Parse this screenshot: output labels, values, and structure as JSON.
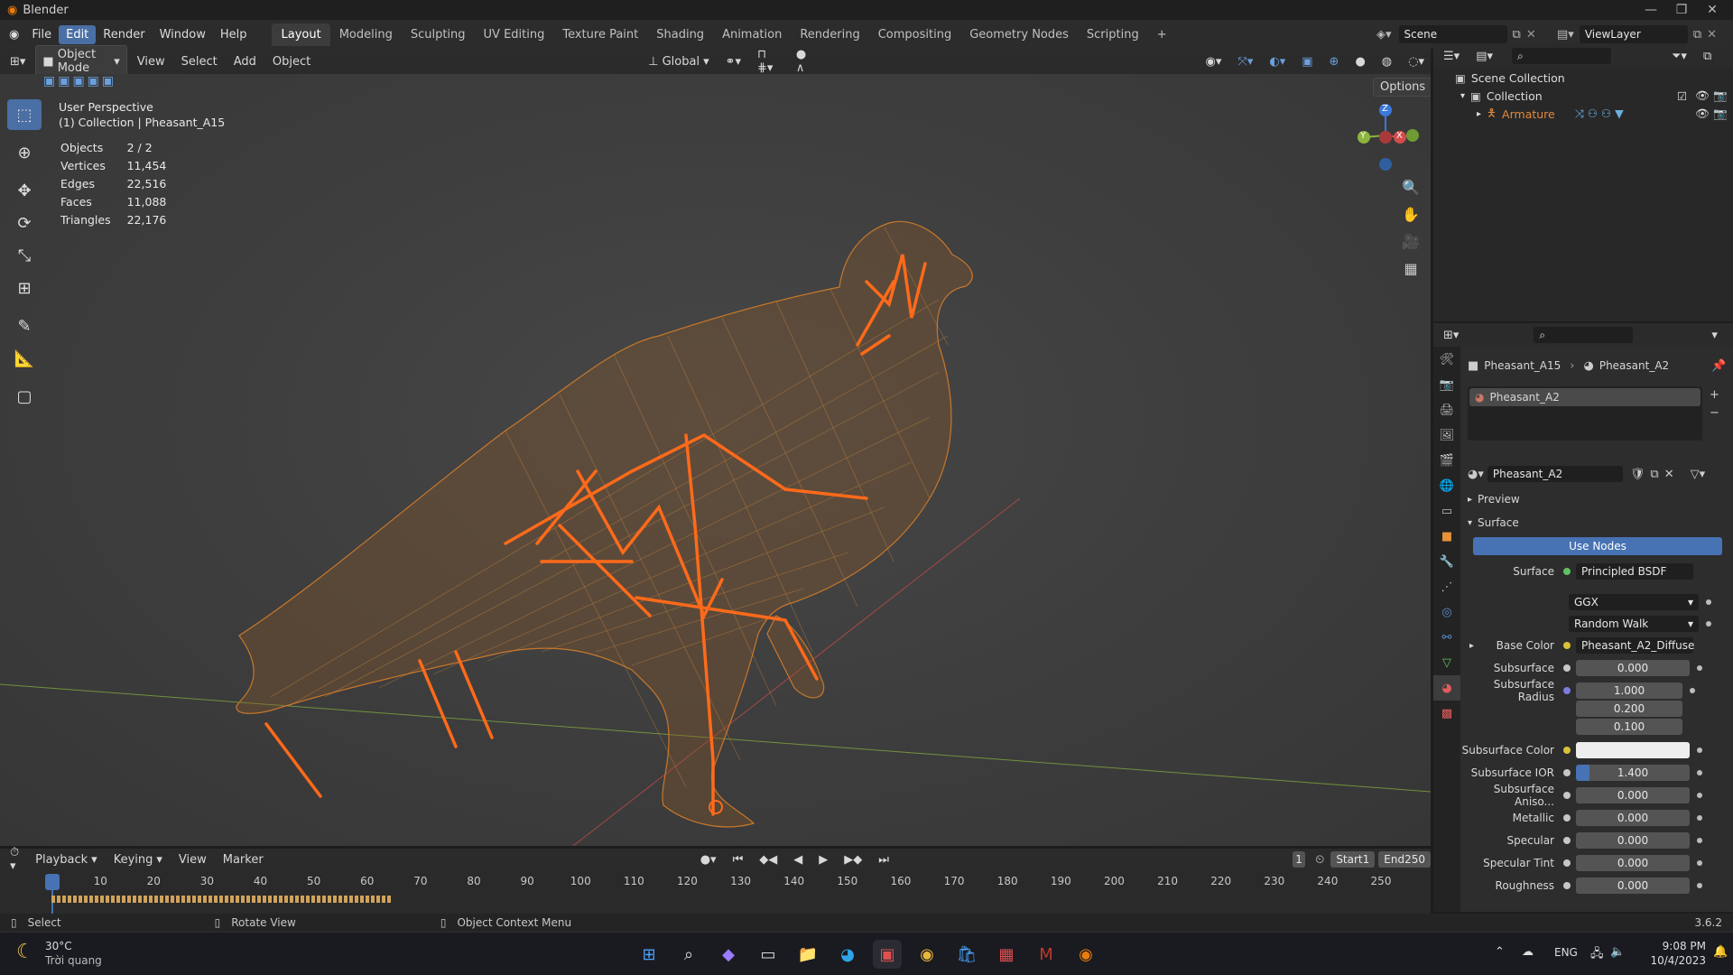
{
  "app": {
    "title": "Blender",
    "version": "3.6.2",
    "menus": [
      "File",
      "Edit",
      "Render",
      "Window",
      "Help"
    ],
    "active_menu": "Edit",
    "workspaces": [
      "Layout",
      "Modeling",
      "Sculpting",
      "UV Editing",
      "Texture Paint",
      "Shading",
      "Animation",
      "Rendering",
      "Compositing",
      "Geometry Nodes",
      "Scripting"
    ],
    "active_workspace": "Layout",
    "scene": "Scene",
    "view_layer": "ViewLayer"
  },
  "viewport_header": {
    "mode": "Object Mode",
    "menus": [
      "View",
      "Select",
      "Add",
      "Object"
    ],
    "orientation": "Global",
    "options_label": "Options"
  },
  "viewport": {
    "perspective": "User Perspective",
    "collection_line": "(1) Collection | Pheasant_A15",
    "stats": [
      {
        "label": "Objects",
        "value": "2 / 2"
      },
      {
        "label": "Vertices",
        "value": "11,454"
      },
      {
        "label": "Edges",
        "value": "22,516"
      },
      {
        "label": "Faces",
        "value": "11,088"
      },
      {
        "label": "Triangles",
        "value": "22,176"
      }
    ],
    "gizmo_axes": [
      "Z",
      "Y",
      "X"
    ],
    "colors": {
      "wire": "#c7772b",
      "bone": "#ff6a1a",
      "axis_x": "#d44b4b",
      "axis_y": "#8cb53c",
      "axis_z": "#3c78d8"
    }
  },
  "outliner": {
    "root": "Scene Collection",
    "collection": "Collection",
    "object": "Armature"
  },
  "properties": {
    "breadcrumb_object": "Pheasant_A15",
    "breadcrumb_material": "Pheasant_A2",
    "slot_name": "Pheasant_A2",
    "material_name": "Pheasant_A2",
    "preview_label": "Preview",
    "surface_section": "Surface",
    "use_nodes": "Use Nodes",
    "surface_label": "Surface",
    "surface_value": "Principled BSDF",
    "distribution": "GGX",
    "subsurface_method": "Random Walk",
    "rows": [
      {
        "label": "Base Color",
        "value": "Pheasant_A2_Diffuse",
        "kind": "link"
      },
      {
        "label": "Subsurface",
        "value": "0.000",
        "kind": "num"
      },
      {
        "label": "Subsurface Radius",
        "value": "1.000",
        "kind": "num"
      },
      {
        "label": "",
        "value": "0.200",
        "kind": "num"
      },
      {
        "label": "",
        "value": "0.100",
        "kind": "num"
      },
      {
        "label": "Subsurface Color",
        "value": "",
        "kind": "color"
      },
      {
        "label": "Subsurface IOR",
        "value": "1.400",
        "kind": "num"
      },
      {
        "label": "Subsurface Aniso...",
        "value": "0.000",
        "kind": "num"
      },
      {
        "label": "Metallic",
        "value": "0.000",
        "kind": "num"
      },
      {
        "label": "Specular",
        "value": "0.000",
        "kind": "num"
      },
      {
        "label": "Specular Tint",
        "value": "0.000",
        "kind": "num"
      },
      {
        "label": "Roughness",
        "value": "0.000",
        "kind": "num"
      }
    ]
  },
  "timeline": {
    "menus": [
      "Playback",
      "Keying",
      "View",
      "Marker"
    ],
    "current_frame": "1",
    "start_label": "Start",
    "start": "1",
    "end_label": "End",
    "end": "250",
    "ticks": [
      "1",
      "10",
      "20",
      "30",
      "40",
      "50",
      "60",
      "70",
      "80",
      "90",
      "100",
      "110",
      "120",
      "130",
      "140",
      "150",
      "160",
      "170",
      "180",
      "190",
      "200",
      "210",
      "220",
      "230",
      "240",
      "250"
    ]
  },
  "statusbar": {
    "select": "Select",
    "rotate": "Rotate View",
    "context": "Object Context Menu"
  },
  "taskbar": {
    "temperature": "30°C",
    "weather": "Trời quang",
    "language": "ENG",
    "time": "9:08 PM",
    "date": "10/4/2023"
  }
}
